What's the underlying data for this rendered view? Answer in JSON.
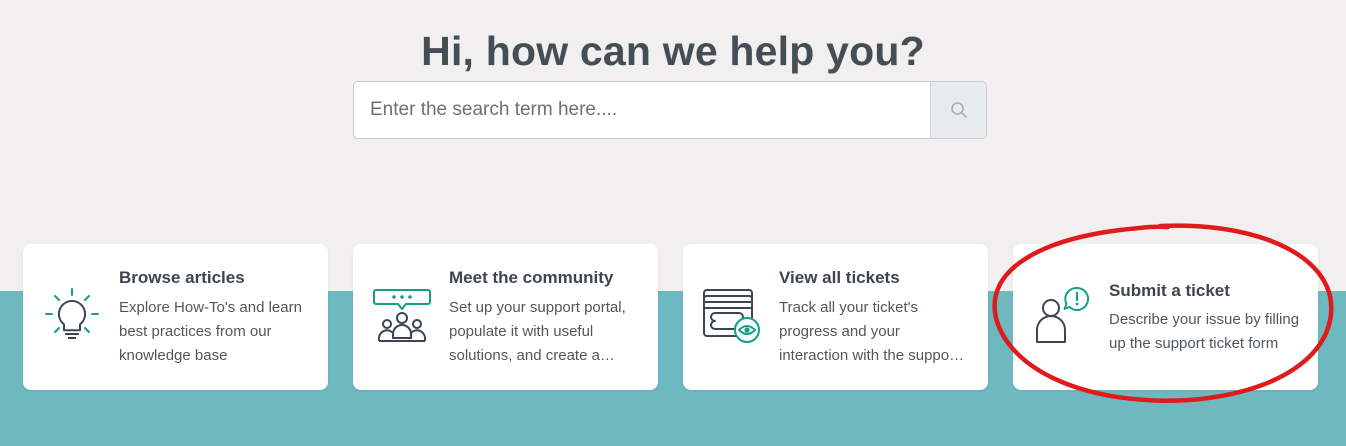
{
  "hero": {
    "title": "Hi, how can we help you?"
  },
  "search": {
    "placeholder": "Enter the search term here....",
    "button_icon": "search-icon"
  },
  "cards": [
    {
      "title": "Browse articles",
      "lines": [
        "Explore How-To's and learn",
        "best practices from our",
        "knowledge base"
      ],
      "icon": "lightbulb-icon"
    },
    {
      "title": "Meet the community",
      "lines": [
        "Set up your support portal,",
        "populate it with useful",
        "solutions, and create a…"
      ],
      "icon": "community-icon"
    },
    {
      "title": "View all tickets",
      "lines": [
        "Track all your ticket's",
        "progress and your",
        "interaction with the suppo…"
      ],
      "icon": "tickets-eye-icon"
    },
    {
      "title": "Submit a ticket",
      "lines": [
        "Describe your issue by filling",
        "up the support ticket form"
      ],
      "icon": "user-alert-icon"
    }
  ],
  "colors": {
    "background": "#f1efef",
    "band": "#6eb8c0",
    "accent": "#13a085",
    "icon_stroke": "#3d4650",
    "annotation": "#e01b1b"
  }
}
